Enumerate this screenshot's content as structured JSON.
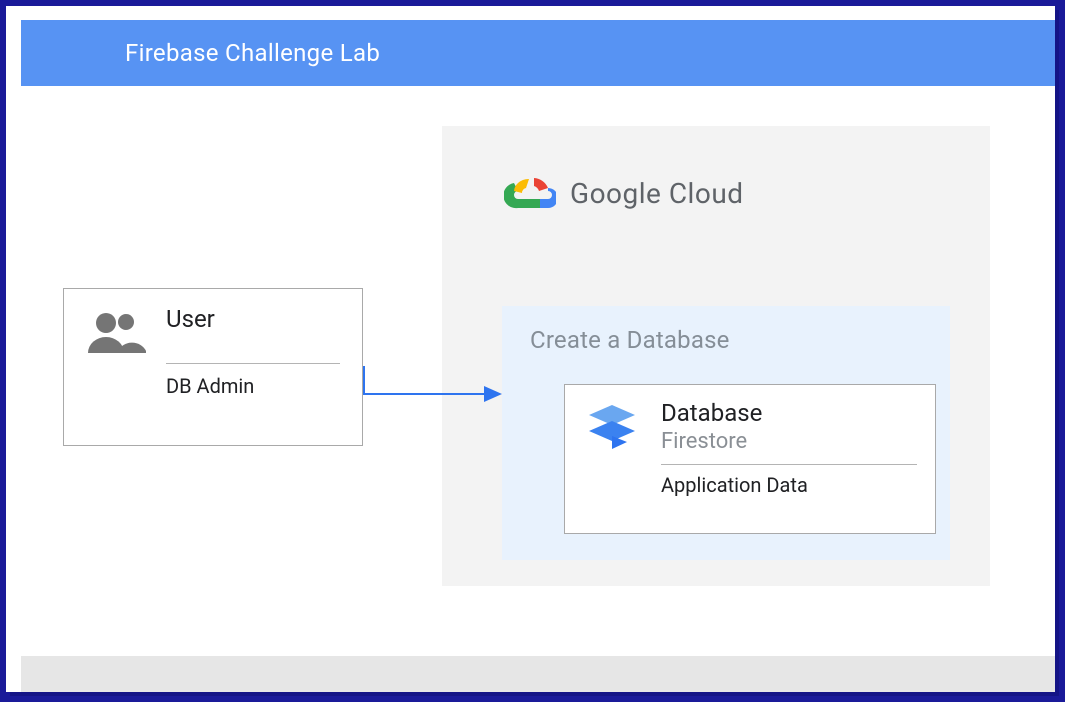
{
  "header": {
    "title": "Firebase Challenge Lab"
  },
  "cloud": {
    "brand": "Google Cloud"
  },
  "createZone": {
    "title": "Create a Database"
  },
  "database": {
    "title": "Database",
    "subtitle": "Firestore",
    "description": "Application Data"
  },
  "user": {
    "title": "User",
    "description": "DB Admin"
  },
  "colors": {
    "headerBg": "#5793f3",
    "cloudZoneBg": "#f3f3f3",
    "createZoneBg": "#e8f2fd",
    "footerBg": "#e6e6e6",
    "frameBg": "#1a1a99",
    "arrow": "#2e74ef"
  }
}
